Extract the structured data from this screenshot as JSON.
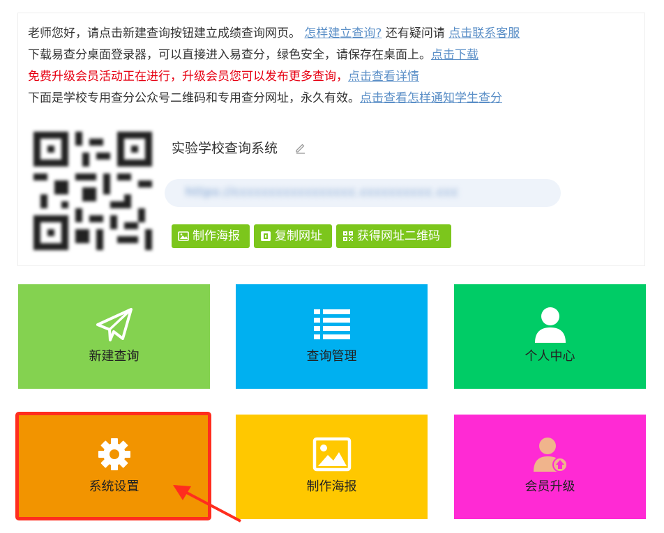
{
  "notices": {
    "line1": {
      "text": "老师您好，请点击新建查询按钮建立成绩查询网页。",
      "link1": "怎样建立查询?",
      "middle": "还有疑问请",
      "link2": "点击联系客服"
    },
    "line2": {
      "text": "下载易查分桌面登录器，可以直接进入易查分，绿色安全，请保存在桌面上。",
      "link": "点击下载"
    },
    "line3": {
      "text": "免费升级会员活动正在进行，升级会员您可以发布更多查询，",
      "link": "点击查看详情"
    },
    "line4": {
      "text": "下面是学校专用查分公众号二维码和专用查分网址，永久有效。",
      "link": "点击查看怎样通知学生查分"
    }
  },
  "school": {
    "name": "实验学校查询系统",
    "edit_icon": "pencil-icon",
    "qr_icon": "qr-code-image"
  },
  "actions": {
    "poster": "制作海报",
    "copy_url": "复制网址",
    "get_qr": "获得网址二维码"
  },
  "tiles": [
    {
      "label": "新建查询",
      "icon": "paper-plane-icon",
      "color": "#84d250"
    },
    {
      "label": "查询管理",
      "icon": "list-icon",
      "color": "#00b0f0"
    },
    {
      "label": "个人中心",
      "icon": "user-icon",
      "color": "#00cc66"
    },
    {
      "label": "系统设置",
      "icon": "gear-icon",
      "color": "#f29400"
    },
    {
      "label": "制作海报",
      "icon": "image-icon",
      "color": "#ffc800"
    },
    {
      "label": "会员升级",
      "icon": "user-upgrade-icon",
      "color": "#ff2ad4"
    }
  ],
  "colors": {
    "link": "#5b8fc7",
    "alert_text": "#e60012",
    "action_button": "#7cc61c",
    "highlight": "#ff2d1e"
  }
}
